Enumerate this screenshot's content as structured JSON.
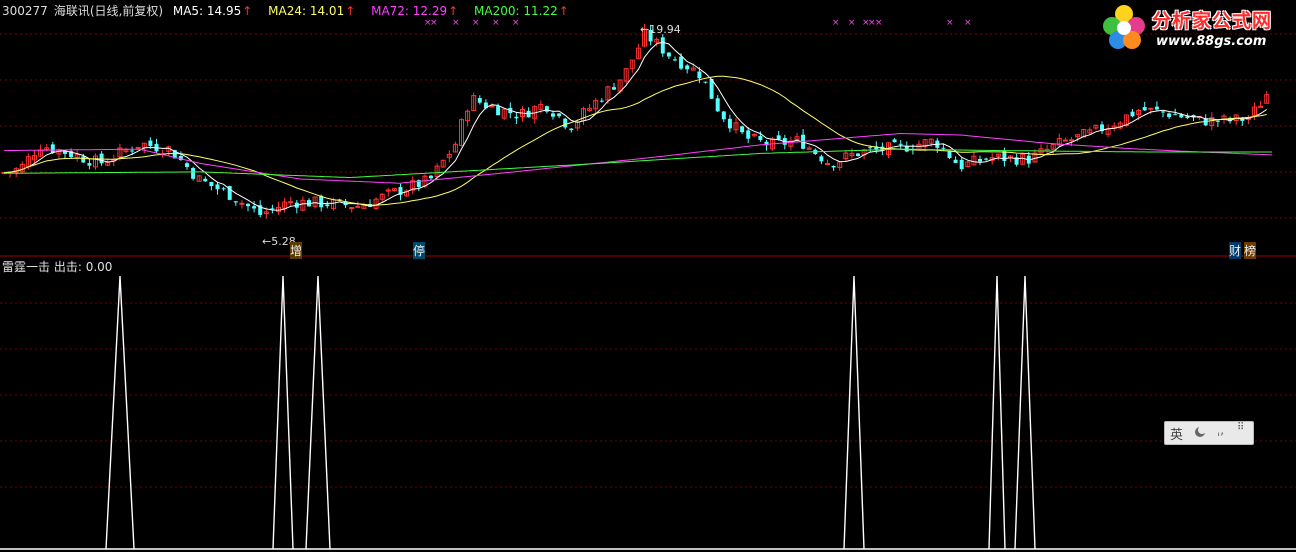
{
  "header": {
    "code": "300277",
    "name": "海联讯",
    "period": "(日线,前复权)",
    "ma5": {
      "label": "MA5: 14.95",
      "color": "#ffffff"
    },
    "ma24": {
      "label": "MA24: 14.01",
      "color": "#ffff66"
    },
    "ma72": {
      "label": "MA72: 12.29",
      "color": "#ff40ff"
    },
    "ma200": {
      "label": "MA200: 11.22",
      "color": "#40ff40"
    },
    "up_arrow": "↑"
  },
  "logo": {
    "title": "分析家公式网",
    "url": "www.88gs.com"
  },
  "price_chart": {
    "high_label": "19.94",
    "low_label": "5.28",
    "bottom_tags": [
      "增",
      "停",
      "财",
      "榜"
    ]
  },
  "indicator": {
    "title": "雷霆一击",
    "label": "出击: 0.00"
  },
  "ime": {
    "mode": "英",
    "icon1": "moon-icon",
    "icon2": "punct-icon",
    "icon3": "grid-icon"
  },
  "colors": {
    "up": "#ff3232",
    "down": "#54ffff",
    "grid": "#7a0000",
    "separator": "#a00000"
  },
  "chart_data": [
    {
      "type": "candlestick",
      "title": "300277 海联讯(日线,前复权)",
      "series": [
        {
          "name": "MA5",
          "last": 14.95
        },
        {
          "name": "MA24",
          "last": 14.01
        },
        {
          "name": "MA72",
          "last": 12.29
        },
        {
          "name": "MA200",
          "last": 11.22
        }
      ],
      "annotations": [
        {
          "text": "19.94",
          "kind": "high"
        },
        {
          "text": "5.28",
          "kind": "low"
        }
      ]
    },
    {
      "type": "line",
      "title": "雷霆一击",
      "series": [
        {
          "name": "出击",
          "last": 0.0
        }
      ]
    }
  ]
}
